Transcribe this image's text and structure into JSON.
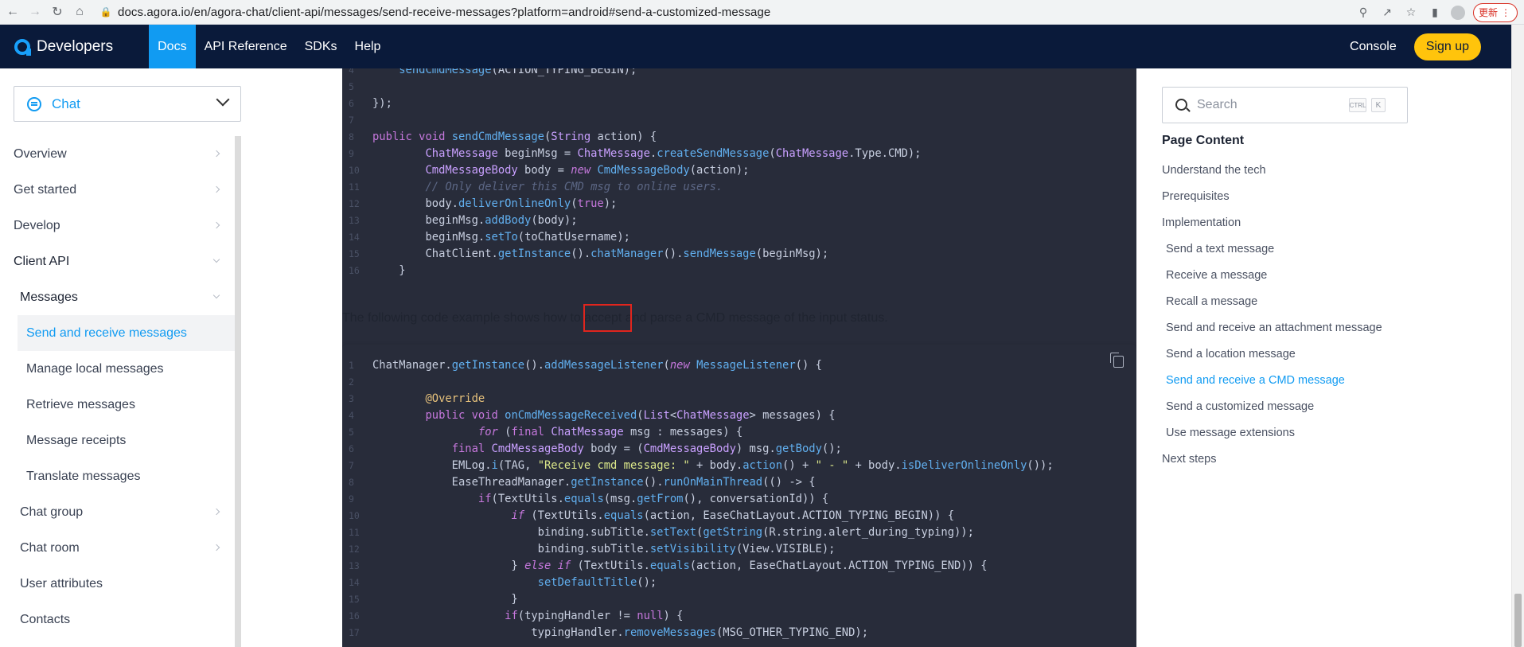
{
  "browser": {
    "url": "docs.agora.io/en/agora-chat/client-api/messages/send-receive-messages?platform=android#send-a-customized-message",
    "update_label": "更新"
  },
  "header": {
    "brand": "Developers",
    "nav": [
      "Docs",
      "API Reference",
      "SDKs",
      "Help"
    ],
    "console": "Console",
    "signup": "Sign up"
  },
  "sidebar": {
    "product": "Chat",
    "items": [
      {
        "label": "Overview"
      },
      {
        "label": "Get started"
      },
      {
        "label": "Develop"
      },
      {
        "label": "Client API"
      },
      {
        "label": "Messages"
      },
      {
        "label": "Send and receive messages"
      },
      {
        "label": "Manage local messages"
      },
      {
        "label": "Retrieve messages"
      },
      {
        "label": "Message receipts"
      },
      {
        "label": "Translate messages"
      },
      {
        "label": "Chat group"
      },
      {
        "label": "Chat room"
      },
      {
        "label": "User attributes"
      },
      {
        "label": "Contacts"
      }
    ]
  },
  "content": {
    "paragraph_before": "The following code example shows how to ",
    "paragraph_highlight": "accept",
    "paragraph_after": " and parse a CMD message of the input status.",
    "top_code_line_numbers": [
      "4",
      "5",
      "6",
      "7",
      "8",
      "9",
      "10",
      "11",
      "12",
      "13",
      "14",
      "15",
      "16"
    ],
    "bottom_code_line_numbers": [
      "1",
      "2",
      "3",
      "4",
      "5",
      "6",
      "7",
      "8",
      "9",
      "10",
      "11",
      "12",
      "13",
      "14",
      "15",
      "16",
      "17"
    ]
  },
  "toc": {
    "search_placeholder": "Search",
    "kbd_ctrl": "CTRL",
    "kbd_k": "K",
    "title": "Page Content",
    "items": [
      {
        "label": "Understand the tech"
      },
      {
        "label": "Prerequisites"
      },
      {
        "label": "Implementation"
      },
      {
        "label": "Send a text message"
      },
      {
        "label": "Receive a message"
      },
      {
        "label": "Recall a message"
      },
      {
        "label": "Send and receive an attachment message"
      },
      {
        "label": "Send a location message"
      },
      {
        "label": "Send and receive a CMD message"
      },
      {
        "label": "Send a customized message"
      },
      {
        "label": "Use message extensions"
      },
      {
        "label": "Next steps"
      }
    ]
  }
}
